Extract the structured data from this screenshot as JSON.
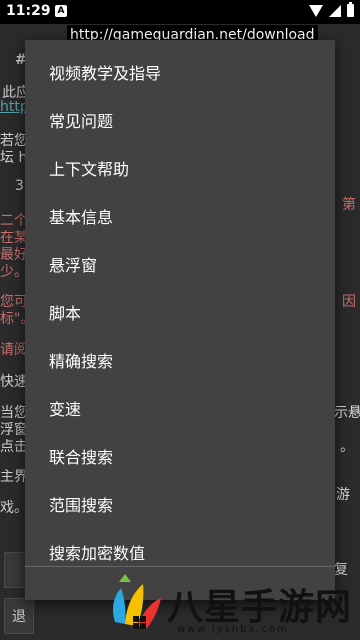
{
  "status": {
    "time": "11:29",
    "notif_letter": "A"
  },
  "url_overlay": "http://gameguardian.net/download",
  "background": {
    "lines": [
      {
        "text": "#",
        "color": "#cfcfcf"
      },
      {
        "text": "此应",
        "color": "#cfcfcf"
      },
      {
        "text": "http",
        "color": "#5aa0a8"
      },
      {
        "text": "若您",
        "color": "#cfcfcf"
      },
      {
        "text": "坛 h",
        "color": "#cfcfcf"
      },
      {
        "text": "3",
        "color": "#cfcfcf"
      },
      {
        "text": "二个",
        "color": "#c87070"
      },
      {
        "text": "在某",
        "color": "#c87070"
      },
      {
        "text": "最好",
        "color": "#c87070"
      },
      {
        "text": "少。",
        "color": "#c87070"
      },
      {
        "text": "您可",
        "color": "#c87070"
      },
      {
        "text": "标\"。",
        "color": "#c87070"
      },
      {
        "text": "请阅",
        "color": "#c87070"
      },
      {
        "text": "快速",
        "color": "#cfcfcf"
      },
      {
        "text": "当您",
        "color": "#cfcfcf"
      },
      {
        "text": "浮窗",
        "color": "#cfcfcf"
      },
      {
        "text": "点击",
        "color": "#cfcfcf"
      },
      {
        "text": "主界",
        "color": "#cfcfcf"
      },
      {
        "text": "戏。",
        "color": "#cfcfcf"
      }
    ],
    "right_fragments": [
      "第",
      "因",
      "示悬",
      "。",
      "游",
      "复"
    ],
    "buttons": [
      "退"
    ]
  },
  "menu": {
    "items": [
      "视频教学及指导",
      "常见问题",
      "上下文帮助",
      "基本信息",
      "悬浮窗",
      "脚本",
      "精确搜索",
      "变速",
      "联合搜索",
      "范围搜索",
      "搜索加密数值"
    ]
  },
  "watermark": {
    "title": "八星手游网",
    "url": "www.lyshbx.com"
  }
}
